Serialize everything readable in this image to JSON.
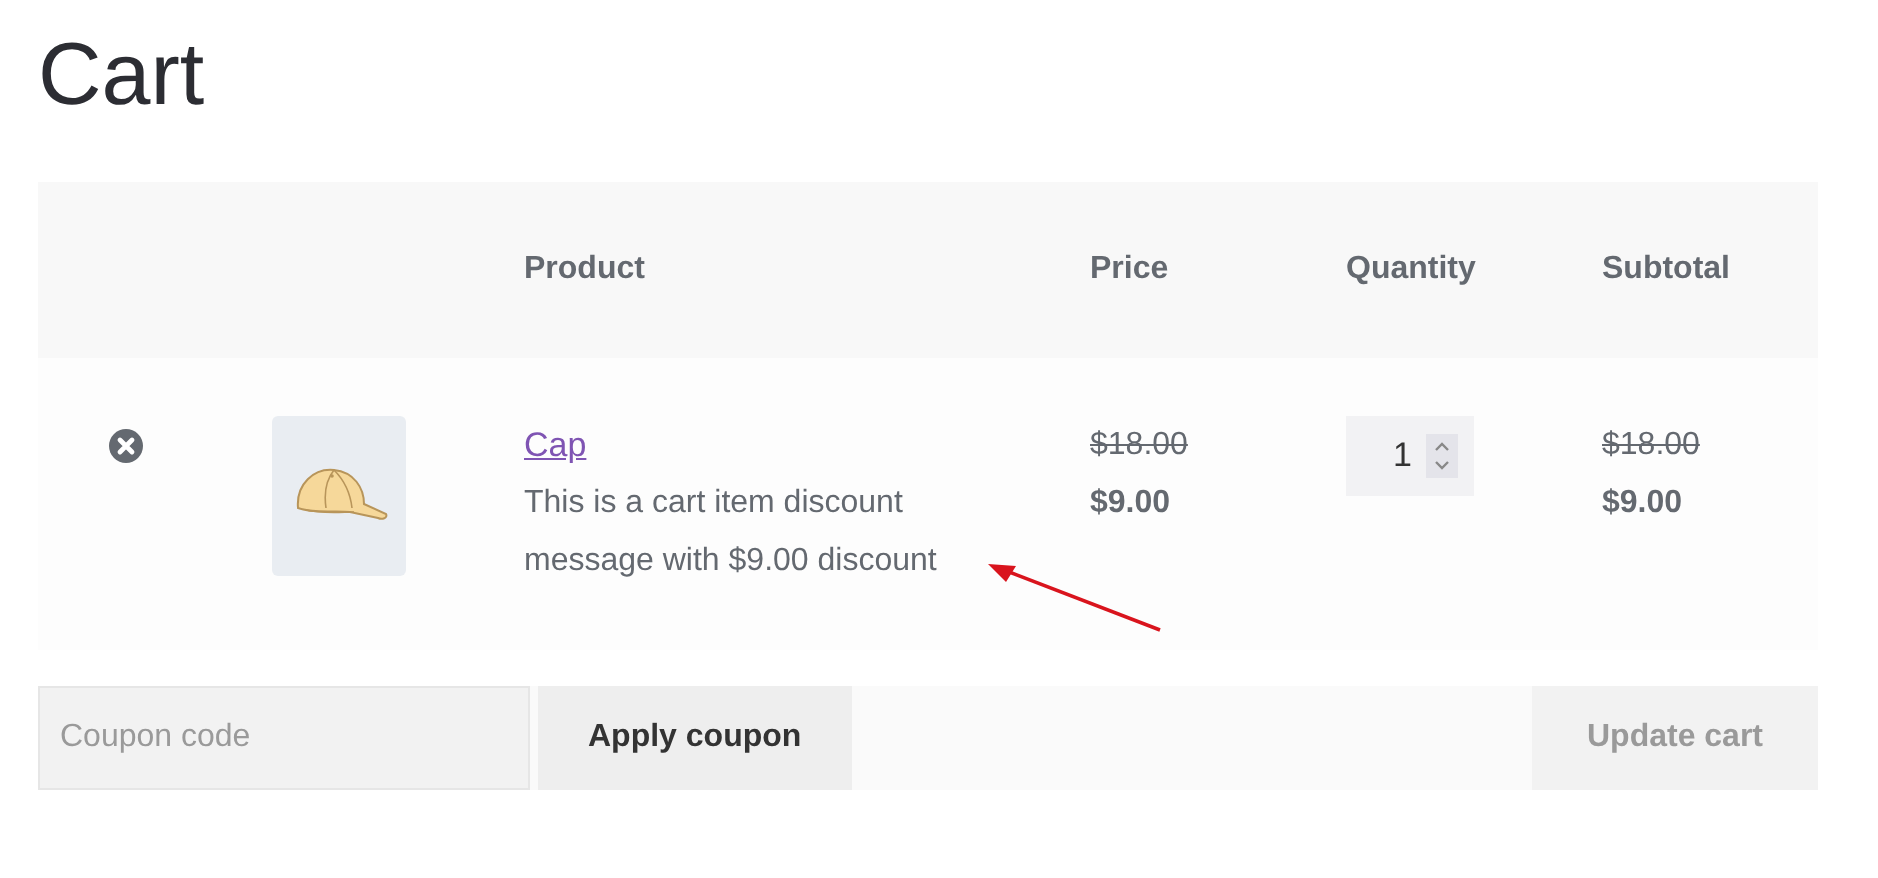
{
  "title": "Cart",
  "table": {
    "columns": [
      "Product",
      "Price",
      "Quantity",
      "Subtotal"
    ],
    "rows": [
      {
        "product": "Cap",
        "message": "This is a cart item discount message with $9.00 discount",
        "original_price": "$18.00",
        "price": "$9.00",
        "quantity": "1",
        "original_subtotal": "$18.00",
        "subtotal": "$9.00"
      }
    ]
  },
  "annotation": {
    "kind": "arrow"
  },
  "coupon": {
    "placeholder": "Coupon code"
  },
  "buttons": [
    {
      "label": "Apply coupon",
      "disabled": false
    },
    {
      "label": "Update cart",
      "disabled": true
    }
  ]
}
